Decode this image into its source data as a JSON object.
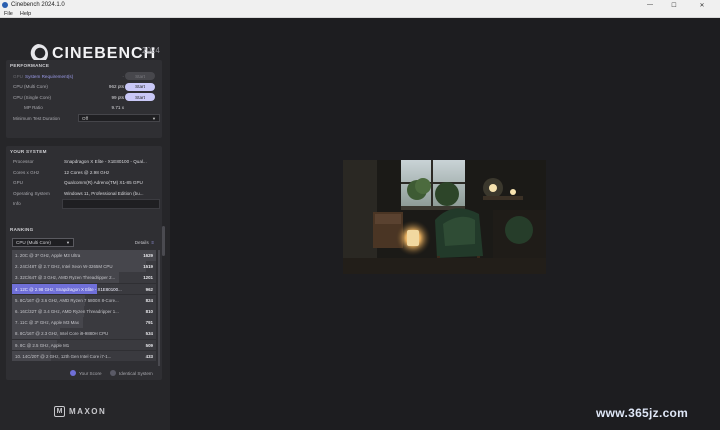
{
  "window": {
    "title": "Cinebench 2024.1.0",
    "minimize": "—",
    "maximize": "☐",
    "close": "✕"
  },
  "menu": {
    "file": "File",
    "help": "Help"
  },
  "logo": {
    "text": "CINEBENCH",
    "version": "2024"
  },
  "performance": {
    "title": "PERFORMANCE",
    "gpu_label": "GPU",
    "gpu_link": "System Requirement(s)",
    "gpu_button": "Start",
    "cpu_multi_label": "CPU (Multi Core)",
    "cpu_multi_value": "962 pts",
    "cpu_multi_button": "Start",
    "cpu_single_label": "CPU (Single Core)",
    "cpu_single_value": "99 pts",
    "cpu_single_button": "Start",
    "mp_ratio_label": "MP Ratio",
    "mp_ratio_value": "9.71 x",
    "min_duration_label": "Minimum Test Duration",
    "min_duration_value": "Off"
  },
  "system": {
    "title": "YOUR SYSTEM",
    "rows": [
      {
        "label": "Processor",
        "value": "Snapdragon X Elite - X1E80100 - Qual..."
      },
      {
        "label": "Cores x GHz",
        "value": "12 Cores @ 2.98 GHz"
      },
      {
        "label": "GPU",
        "value": "Qualcomm(R) Adreno(TM) X1-85 GPU"
      },
      {
        "label": "Operating System",
        "value": "Windows 11, Professional Edition (bu..."
      }
    ],
    "info_label": "Info"
  },
  "ranking": {
    "title": "RANKING",
    "select_value": "CPU (Multi Core)",
    "details_label": "Details",
    "rows": [
      {
        "name": "1. 20C @ 3* GHz, Apple M3 Ultra",
        "score": "1629",
        "fraction": 1.0,
        "you": false
      },
      {
        "name": "2. 24C/48T @ 2.7 GHz, Intel Xeon W-3265M CPU",
        "score": "1519",
        "fraction": 0.93,
        "you": false
      },
      {
        "name": "3. 32C/64T @ 3 GHz, AMD Ryzen Threadripper 2...",
        "score": "1201",
        "fraction": 0.74,
        "you": false
      },
      {
        "name": "4. 12C @ 2.98 GHz, Snapdragon X Elite - X1E80100...",
        "score": "962",
        "fraction": 0.59,
        "you": true
      },
      {
        "name": "5. 8C/16T @ 3.6 GHz, AMD Ryzen 7 5800X 8-Core...",
        "score": "824",
        "fraction": 0.51,
        "you": false
      },
      {
        "name": "6. 16C/32T @ 3.4 GHz, AMD Ryzen Threadripper 1...",
        "score": "810",
        "fraction": 0.5,
        "you": false
      },
      {
        "name": "7. 11C @ 3* GHz, Apple M3 Max",
        "score": "791",
        "fraction": 0.49,
        "you": false
      },
      {
        "name": "8. 8C/16T @ 2.3 GHz, Intel Core i9-9880H CPU",
        "score": "534",
        "fraction": 0.33,
        "you": false
      },
      {
        "name": "9. 8C @ 2.5 GHz, Apple M1",
        "score": "509",
        "fraction": 0.31,
        "you": false
      },
      {
        "name": "10. 14C/20T @ 2 GHz, 12th Gen Intel Core i7-1...",
        "score": "433",
        "fraction": 0.27,
        "you": false
      }
    ],
    "legend_your_score": "Your Score",
    "legend_identical": "Identical System",
    "colors": {
      "your_score": "#6f6fd8",
      "identical": "#5a5a66"
    }
  },
  "footer": {
    "brand": "MAXON",
    "brand_icon": "M"
  },
  "watermark": "www.365jz.com"
}
